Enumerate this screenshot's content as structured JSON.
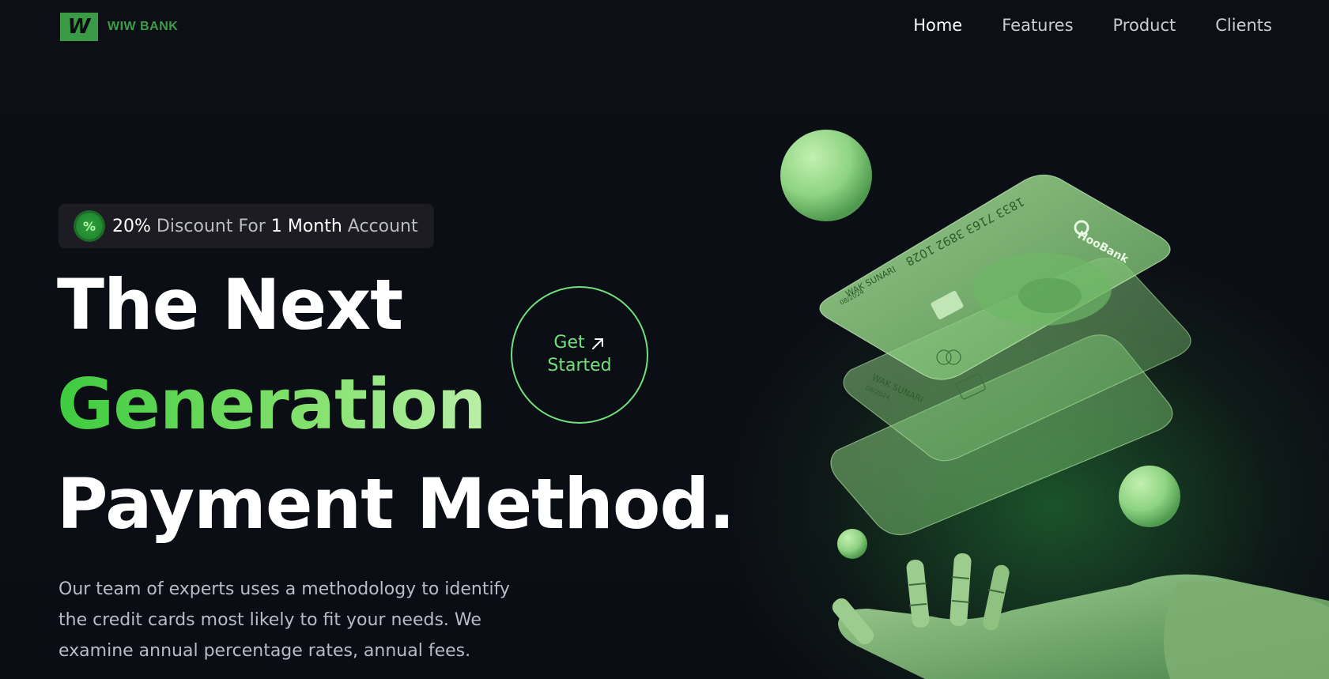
{
  "brand": {
    "logo_letter": "W",
    "name": "WIW BANK"
  },
  "nav": {
    "items": [
      {
        "label": "Home",
        "active": true
      },
      {
        "label": "Features",
        "active": false
      },
      {
        "label": "Product",
        "active": false
      },
      {
        "label": "Clients",
        "active": false
      }
    ]
  },
  "badge": {
    "icon": "percent-badge-icon",
    "part1": "20%",
    "part2": " Discount For ",
    "part3": "1 Month",
    "part4": " Account"
  },
  "hero": {
    "line1": "The Next",
    "line2": "Generation",
    "line3": "Payment Method.",
    "cta_line1": "Get",
    "cta_line2": "Started",
    "cta_icon": "arrow-up-right-icon",
    "description": "Our team of experts uses a methodology to identify the credit cards most likely to fit your needs. We examine annual percentage rates, annual fees."
  },
  "card": {
    "number": "1833 7163 3892 1028",
    "bank": "HooBank",
    "holder": "WAK SUNARI",
    "expiry": "08/2024"
  },
  "colors": {
    "background": "#0b0d14",
    "accent_green": "#6fe07a",
    "logo_green": "#3b9a45",
    "text_muted": "#b8bcc4"
  }
}
